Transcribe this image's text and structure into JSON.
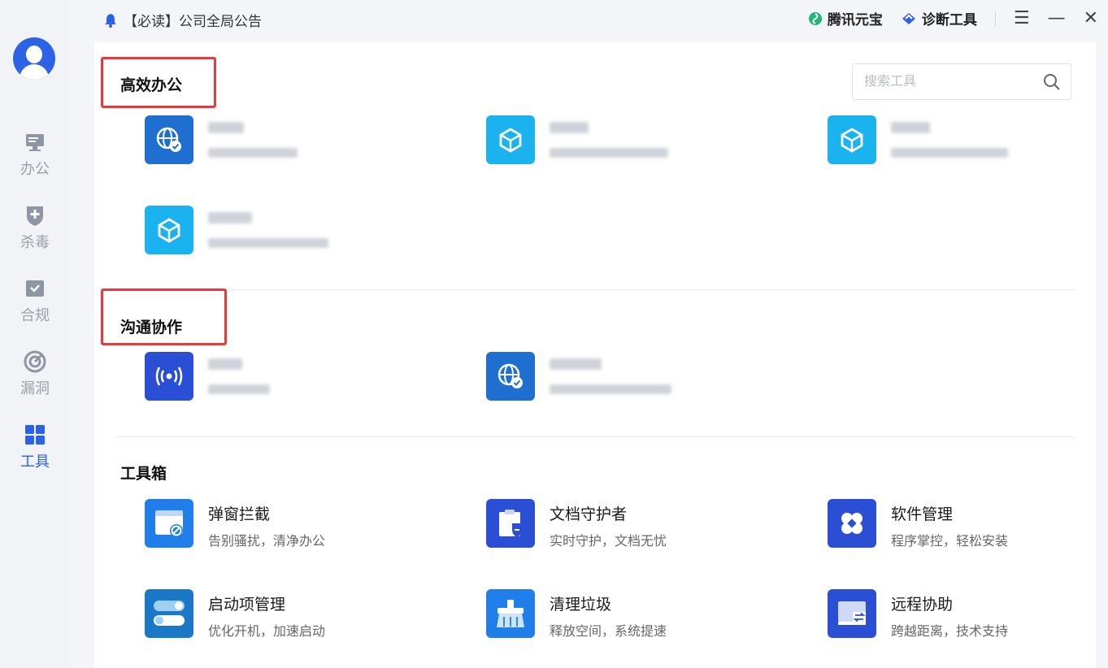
{
  "sidebar": {
    "items": [
      {
        "label": "办公",
        "icon": "monitor-icon"
      },
      {
        "label": "杀毒",
        "icon": "shield-plus-icon"
      },
      {
        "label": "合规",
        "icon": "check-box-icon"
      },
      {
        "label": "漏洞",
        "icon": "radar-icon"
      },
      {
        "label": "工具",
        "icon": "grid-icon"
      }
    ],
    "active": "工具"
  },
  "topbar": {
    "notice": "【必读】公司全局公告",
    "yuanbao": "腾讯元宝",
    "diagnose": "诊断工具"
  },
  "search": {
    "placeholder": "搜索工具"
  },
  "sections": {
    "office": {
      "title": "高效办公"
    },
    "collab": {
      "title": "沟通协作"
    },
    "toolbox": {
      "title": "工具箱"
    }
  },
  "toolbox": [
    {
      "name": "弹窗拦截",
      "desc": "告别骚扰，清净办公",
      "icon": "popup-block-icon"
    },
    {
      "name": "文档守护者",
      "desc": "实时守护，文档无忧",
      "icon": "document-guard-icon"
    },
    {
      "name": "软件管理",
      "desc": "程序掌控，轻松安装",
      "icon": "software-manage-icon"
    },
    {
      "name": "启动项管理",
      "desc": "优化开机，加速启动",
      "icon": "startup-toggle-icon"
    },
    {
      "name": "清理垃圾",
      "desc": "释放空间，系统提速",
      "icon": "broom-icon"
    },
    {
      "name": "远程协助",
      "desc": "跨越距离，技术支持",
      "icon": "remote-assist-icon"
    }
  ],
  "colors": {
    "accent": "#2c63e6",
    "highlight": "#e83a3a",
    "tool_blue": "#1f6fd0",
    "tool_cyan": "#1ab2ef",
    "tool_indigo": "#2a4fd4"
  }
}
